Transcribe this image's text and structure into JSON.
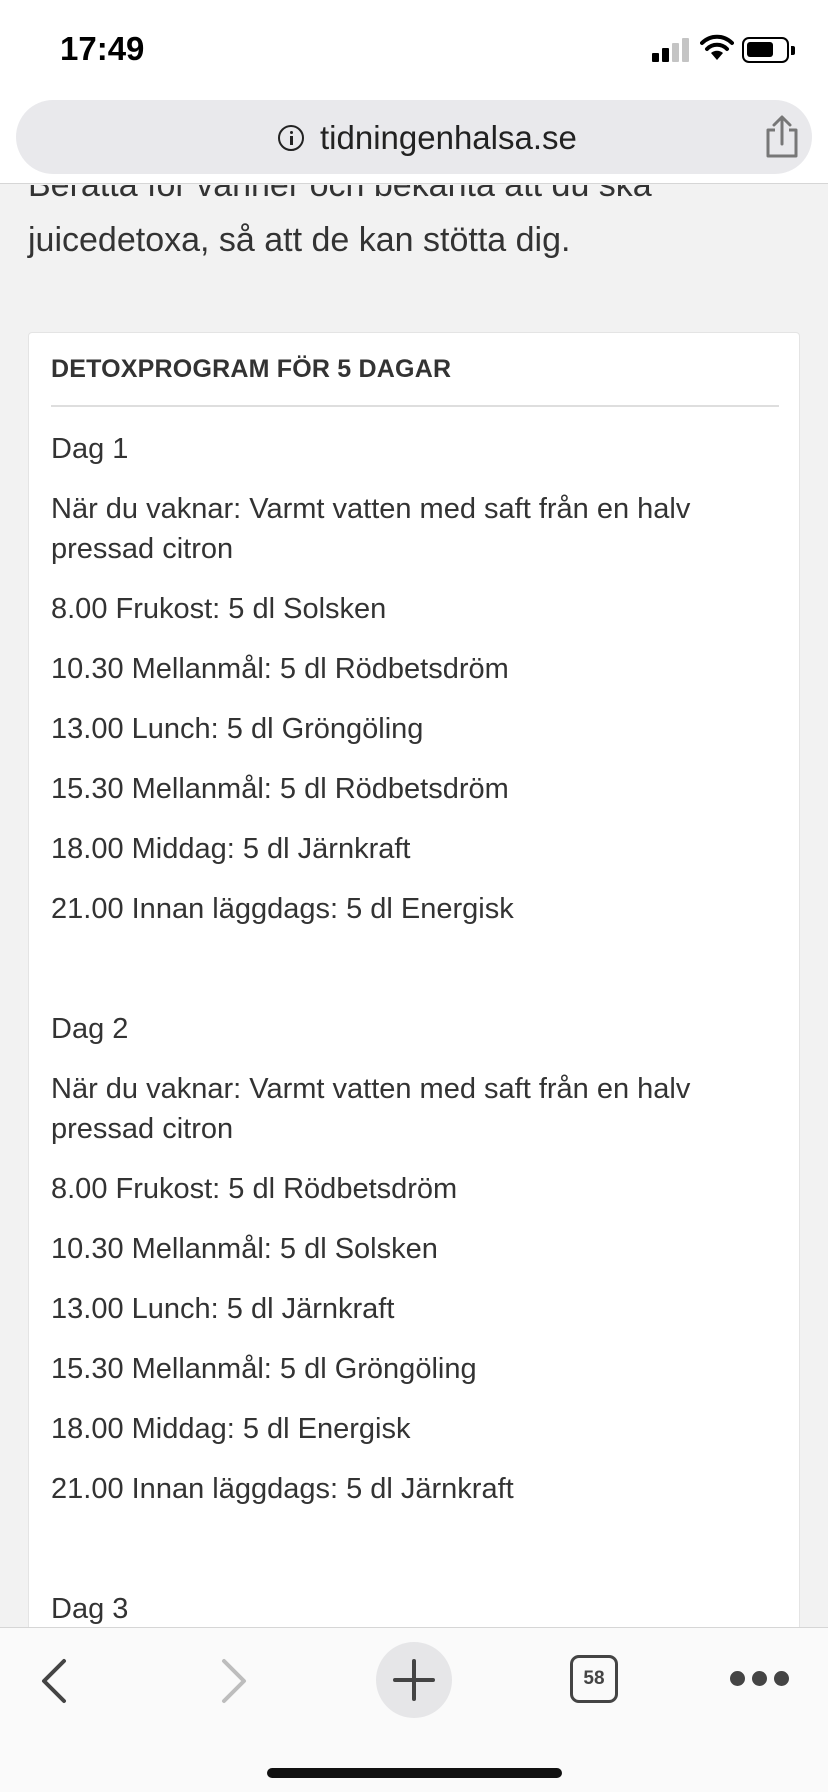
{
  "status_bar": {
    "time": "17:49"
  },
  "browser": {
    "url": "tidningenhalsa.se",
    "tab_count": "58"
  },
  "article": {
    "intro_line_1": "Berätta för vänner och bekanta att du ska",
    "intro_line_2": "juicedetoxa, så att de kan stötta dig.",
    "box_title": "DETOXPROGRAM FÖR 5 DAGAR",
    "days": [
      {
        "title": "Dag 1",
        "entries": [
          "När du vaknar: Varmt vatten med saft från en halv pressad citron",
          "8.00 Frukost: 5 dl Solsken",
          "10.30 Mellanmål: 5 dl Rödbetsdröm",
          "13.00 Lunch: 5 dl Gröngöling",
          "15.30 Mellanmål: 5 dl Rödbetsdröm",
          "18.00 Middag: 5 dl Järnkraft",
          "21.00 Innan läggdags: 5 dl Energisk"
        ]
      },
      {
        "title": "Dag 2",
        "entries": [
          "När du vaknar: Varmt vatten med saft från en halv pressad citron",
          "8.00 Frukost: 5 dl Rödbetsdröm",
          "10.30 Mellanmål: 5 dl Solsken",
          "13.00 Lunch: 5 dl Järnkraft",
          "15.30 Mellanmål: 5 dl Gröngöling",
          "18.00 Middag: 5 dl Energisk",
          "21.00 Innan läggdags: 5 dl Järnkraft"
        ]
      },
      {
        "title": "Dag 3",
        "entries": []
      }
    ]
  }
}
